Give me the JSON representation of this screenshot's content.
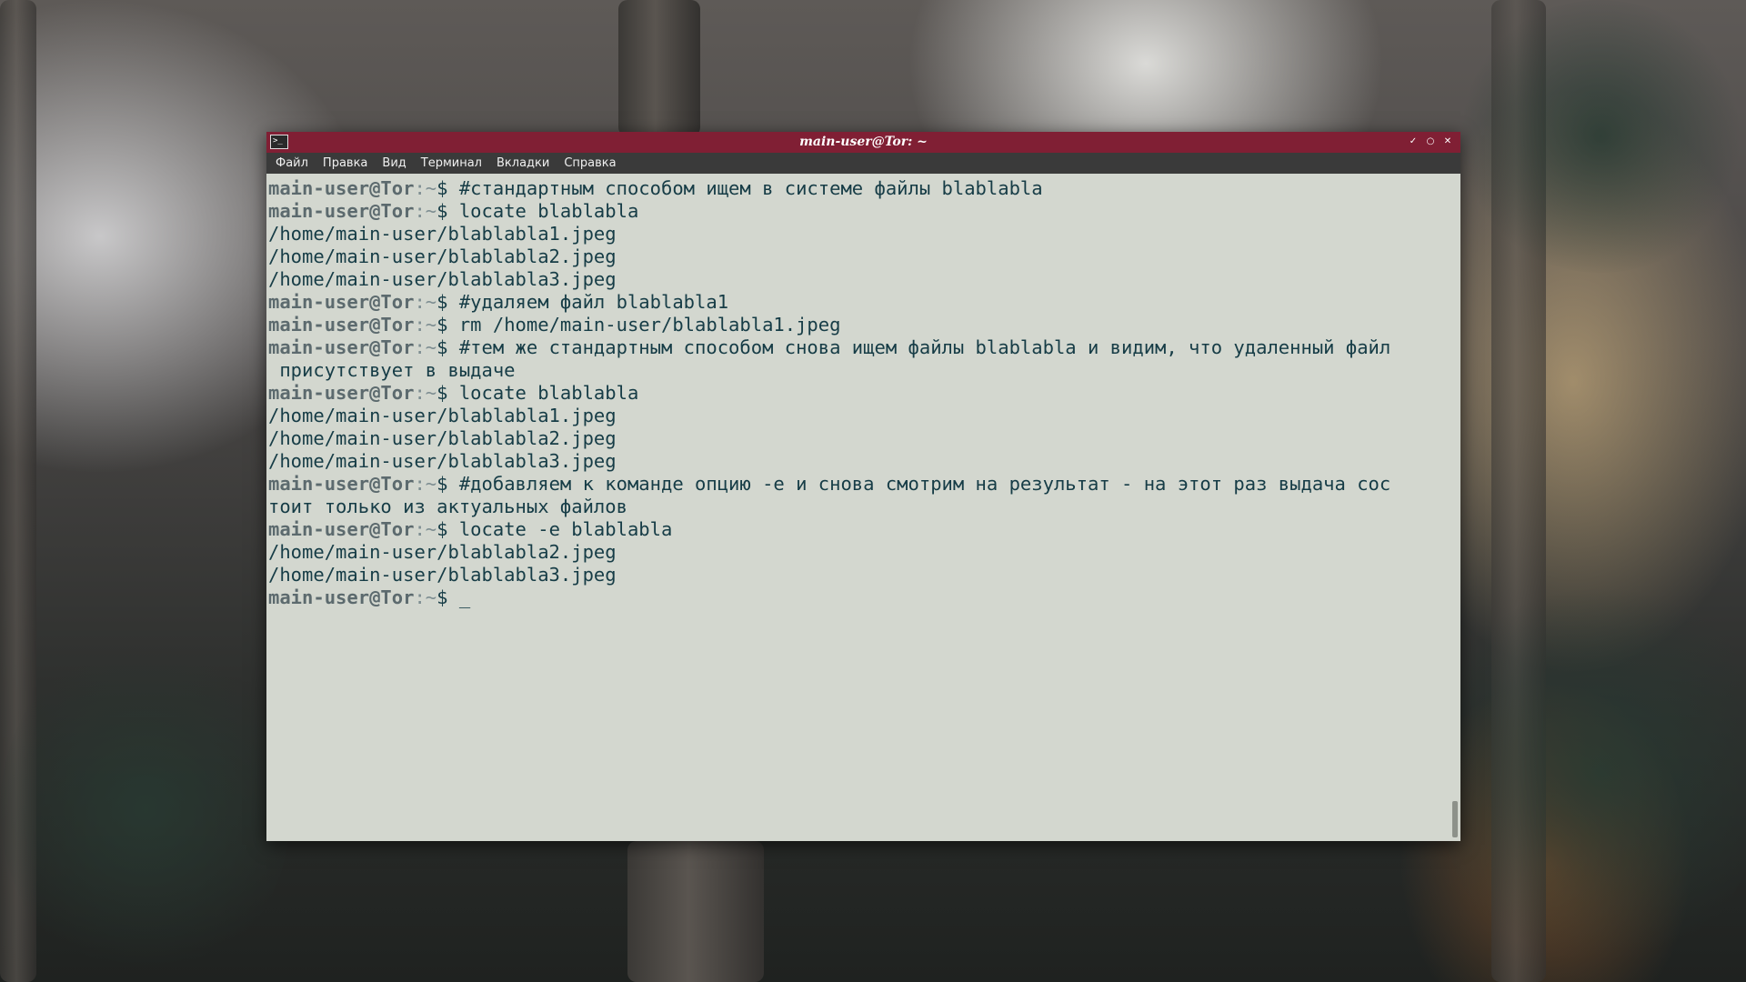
{
  "window": {
    "title": "main-user@Tor: ~",
    "icon": "terminal-icon",
    "controls": [
      "minimize-icon",
      "maximize-icon",
      "close-icon"
    ],
    "titlebar_color": "#801f34"
  },
  "menu": {
    "items": [
      "Файл",
      "Правка",
      "Вид",
      "Терминал",
      "Вкладки",
      "Справка"
    ]
  },
  "terminal": {
    "prompt_user": "main-user@Tor",
    "prompt_path": ":~",
    "prompt_sign": "$ ",
    "cursor": "_",
    "lines": [
      {
        "type": "cmd",
        "text": "#стандартным способом ищем в системе файлы blablabla"
      },
      {
        "type": "cmd",
        "text": "locate blablabla"
      },
      {
        "type": "out",
        "text": "/home/main-user/blablabla1.jpeg"
      },
      {
        "type": "out",
        "text": "/home/main-user/blablabla2.jpeg"
      },
      {
        "type": "out",
        "text": "/home/main-user/blablabla3.jpeg"
      },
      {
        "type": "cmd",
        "text": "#удаляем файл blablabla1"
      },
      {
        "type": "cmd",
        "text": "rm /home/main-user/blablabla1.jpeg"
      },
      {
        "type": "cmd",
        "text": "#тем же стандартным способом снова ищем файлы blablabla и видим, что удаленный файл"
      },
      {
        "type": "out",
        "text": " присутствует в выдаче"
      },
      {
        "type": "cmd",
        "text": "locate blablabla"
      },
      {
        "type": "out",
        "text": "/home/main-user/blablabla1.jpeg"
      },
      {
        "type": "out",
        "text": "/home/main-user/blablabla2.jpeg"
      },
      {
        "type": "out",
        "text": "/home/main-user/blablabla3.jpeg"
      },
      {
        "type": "cmd",
        "text": "#добавляем к команде опцию -e и снова смотрим на результат - на этот раз выдача сос"
      },
      {
        "type": "out",
        "text": "тоит только из актуальных файлов"
      },
      {
        "type": "cmd",
        "text": "locate -e blablabla"
      },
      {
        "type": "out",
        "text": "/home/main-user/blablabla2.jpeg"
      },
      {
        "type": "out",
        "text": "/home/main-user/blablabla3.jpeg"
      },
      {
        "type": "prompt",
        "text": ""
      }
    ]
  }
}
